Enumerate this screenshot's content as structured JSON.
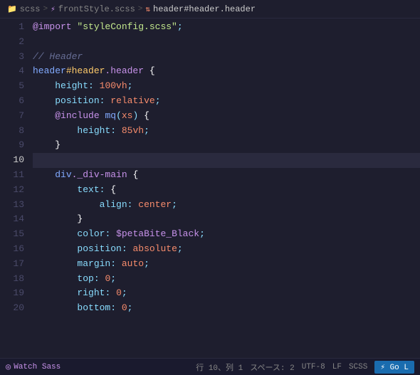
{
  "breadcrumb": {
    "items": [
      {
        "label": "scss",
        "icon": "folder"
      },
      {
        "label": "frontStyle.scss",
        "icon": "sass-file"
      },
      {
        "label": "header#header.header",
        "icon": "symbol"
      }
    ]
  },
  "editor": {
    "lines": [
      {
        "number": 1,
        "tokens": [
          {
            "type": "at-keyword",
            "text": "@import"
          },
          {
            "type": "plain",
            "text": " "
          },
          {
            "type": "string",
            "text": "\"styleConfig.scss\""
          }
        ],
        "suffix": {
          "type": "punctuation",
          "text": ";"
        }
      },
      {
        "number": 2,
        "tokens": []
      },
      {
        "number": 3,
        "tokens": [
          {
            "type": "comment",
            "text": "// Header"
          }
        ]
      },
      {
        "number": 4,
        "tokens": [
          {
            "type": "selector",
            "text": "header"
          },
          {
            "type": "selector-id",
            "text": "#header"
          },
          {
            "type": "selector-class",
            "text": ".header"
          },
          {
            "type": "plain",
            "text": " "
          },
          {
            "type": "brace",
            "text": "{"
          }
        ]
      },
      {
        "number": 5,
        "tokens": [
          {
            "type": "indent",
            "text": "    "
          },
          {
            "type": "property",
            "text": "height"
          },
          {
            "type": "punctuation",
            "text": ":"
          },
          {
            "type": "plain",
            "text": " "
          },
          {
            "type": "value",
            "text": "100vh"
          },
          {
            "type": "punctuation",
            "text": ";"
          }
        ]
      },
      {
        "number": 6,
        "tokens": [
          {
            "type": "indent",
            "text": "    "
          },
          {
            "type": "property",
            "text": "position"
          },
          {
            "type": "punctuation",
            "text": ":"
          },
          {
            "type": "plain",
            "text": " "
          },
          {
            "type": "value",
            "text": "relative"
          },
          {
            "type": "punctuation",
            "text": ";"
          }
        ]
      },
      {
        "number": 7,
        "tokens": [
          {
            "type": "indent",
            "text": "    "
          },
          {
            "type": "at-keyword",
            "text": "@include"
          },
          {
            "type": "plain",
            "text": " "
          },
          {
            "type": "function-name",
            "text": "mq"
          },
          {
            "type": "punctuation",
            "text": "("
          },
          {
            "type": "param",
            "text": "xs"
          },
          {
            "type": "punctuation",
            "text": ")"
          },
          {
            "type": "plain",
            "text": " "
          },
          {
            "type": "brace",
            "text": "{"
          }
        ]
      },
      {
        "number": 8,
        "tokens": [
          {
            "type": "indent",
            "text": "        "
          },
          {
            "type": "property",
            "text": "height"
          },
          {
            "type": "punctuation",
            "text": ":"
          },
          {
            "type": "plain",
            "text": " "
          },
          {
            "type": "value",
            "text": "85vh"
          },
          {
            "type": "punctuation",
            "text": ";"
          }
        ]
      },
      {
        "number": 9,
        "tokens": [
          {
            "type": "indent",
            "text": "    "
          },
          {
            "type": "brace",
            "text": "}"
          }
        ]
      },
      {
        "number": 10,
        "tokens": [],
        "active": true
      },
      {
        "number": 11,
        "tokens": [
          {
            "type": "indent",
            "text": "    "
          },
          {
            "type": "selector",
            "text": "div"
          },
          {
            "type": "selector-class",
            "text": "._div-main"
          },
          {
            "type": "plain",
            "text": " "
          },
          {
            "type": "brace",
            "text": "{"
          }
        ]
      },
      {
        "number": 12,
        "tokens": [
          {
            "type": "indent",
            "text": "        "
          },
          {
            "type": "property",
            "text": "text"
          },
          {
            "type": "punctuation",
            "text": ":"
          },
          {
            "type": "plain",
            "text": " "
          },
          {
            "type": "brace",
            "text": "{"
          }
        ]
      },
      {
        "number": 13,
        "tokens": [
          {
            "type": "indent",
            "text": "            "
          },
          {
            "type": "property",
            "text": "align"
          },
          {
            "type": "punctuation",
            "text": ":"
          },
          {
            "type": "plain",
            "text": " "
          },
          {
            "type": "value",
            "text": "center"
          },
          {
            "type": "punctuation",
            "text": ";"
          }
        ]
      },
      {
        "number": 14,
        "tokens": [
          {
            "type": "indent",
            "text": "        "
          },
          {
            "type": "brace",
            "text": "}"
          }
        ]
      },
      {
        "number": 15,
        "tokens": [
          {
            "type": "indent",
            "text": "        "
          },
          {
            "type": "property",
            "text": "color"
          },
          {
            "type": "punctuation",
            "text": ":"
          },
          {
            "type": "plain",
            "text": " "
          },
          {
            "type": "value-variable",
            "text": "$petaBite_Black"
          },
          {
            "type": "punctuation",
            "text": ";"
          }
        ]
      },
      {
        "number": 16,
        "tokens": [
          {
            "type": "indent",
            "text": "        "
          },
          {
            "type": "property",
            "text": "position"
          },
          {
            "type": "punctuation",
            "text": ":"
          },
          {
            "type": "plain",
            "text": " "
          },
          {
            "type": "value",
            "text": "absolute"
          },
          {
            "type": "punctuation",
            "text": ";"
          }
        ]
      },
      {
        "number": 17,
        "tokens": [
          {
            "type": "indent",
            "text": "        "
          },
          {
            "type": "property",
            "text": "margin"
          },
          {
            "type": "punctuation",
            "text": ":"
          },
          {
            "type": "plain",
            "text": " "
          },
          {
            "type": "value",
            "text": "auto"
          },
          {
            "type": "punctuation",
            "text": ";"
          }
        ]
      },
      {
        "number": 18,
        "tokens": [
          {
            "type": "indent",
            "text": "        "
          },
          {
            "type": "property",
            "text": "top"
          },
          {
            "type": "punctuation",
            "text": ":"
          },
          {
            "type": "plain",
            "text": " "
          },
          {
            "type": "value",
            "text": "0"
          },
          {
            "type": "punctuation",
            "text": ";"
          }
        ]
      },
      {
        "number": 19,
        "tokens": [
          {
            "type": "indent",
            "text": "        "
          },
          {
            "type": "property",
            "text": "right"
          },
          {
            "type": "punctuation",
            "text": ":"
          },
          {
            "type": "plain",
            "text": " "
          },
          {
            "type": "value",
            "text": "0"
          },
          {
            "type": "punctuation",
            "text": ";"
          }
        ]
      },
      {
        "number": 20,
        "tokens": [
          {
            "type": "indent",
            "text": "        "
          },
          {
            "type": "property",
            "text": "bottom"
          },
          {
            "type": "punctuation",
            "text": ":"
          },
          {
            "type": "plain",
            "text": " "
          },
          {
            "type": "value",
            "text": "0"
          },
          {
            "type": "punctuation",
            "text": ";"
          }
        ]
      }
    ]
  },
  "statusBar": {
    "watch": "Watch Sass",
    "position": "行 10、列 1",
    "spaces": "スペース: 2",
    "encoding": "UTF-8",
    "lineEnding": "LF",
    "language": "SCSS",
    "goLive": "⚡ Go L"
  }
}
